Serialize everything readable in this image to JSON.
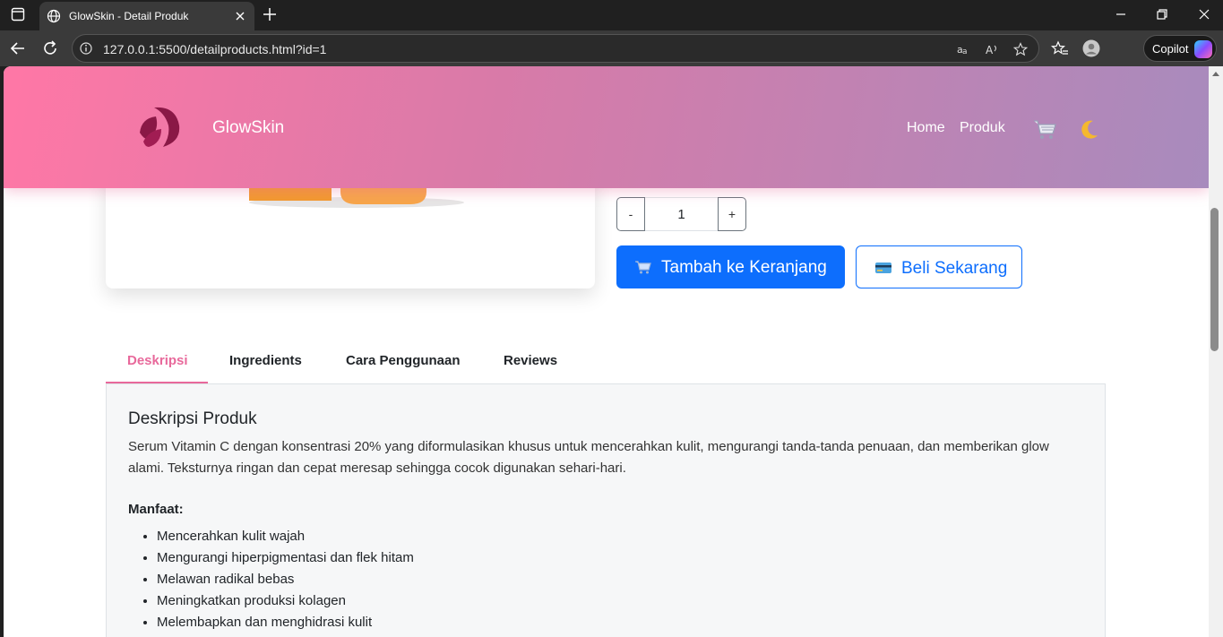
{
  "browser": {
    "tab_title": "GlowSkin - Detail Produk",
    "url": "127.0.0.1:5500/detailproducts.html?id=1",
    "copilot_label": "Copilot"
  },
  "navbar": {
    "brand": "GlowSkin",
    "links": [
      "Home",
      "Produk"
    ]
  },
  "product": {
    "quantity": "1",
    "minus_label": "-",
    "plus_label": "+",
    "add_to_cart_label": "Tambah ke Keranjang",
    "buy_now_label": "Beli Sekarang"
  },
  "tabs": {
    "items": [
      "Deskripsi",
      "Ingredients",
      "Cara Penggunaan",
      "Reviews"
    ],
    "active": "Deskripsi"
  },
  "description": {
    "title": "Deskripsi Produk",
    "text": "Serum Vitamin C dengan konsentrasi 20% yang diformulasikan khusus untuk mencerahkan kulit, mengurangi tanda-tanda penuaan, dan memberikan glow alami. Teksturnya ringan dan cepat meresap sehingga cocok digunakan sehari-hari.",
    "benefits_title": "Manfaat:",
    "benefits": [
      "Mencerahkan kulit wajah",
      "Mengurangi hiperpigmentasi dan flek hitam",
      "Melawan radikal bebas",
      "Meningkatkan produksi kolagen",
      "Melembapkan dan menghidrasi kulit"
    ]
  },
  "colors": {
    "accent_pink": "#e8699b",
    "primary_blue": "#0d6efd"
  }
}
